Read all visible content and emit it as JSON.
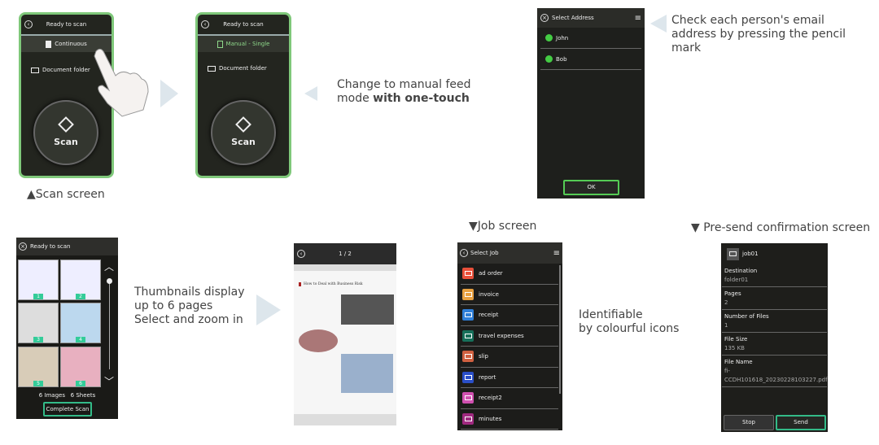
{
  "scan_screen_1": {
    "title": "Ready to scan",
    "mode": "Continuous",
    "folder": "Document folder",
    "scan": "Scan"
  },
  "scan_screen_2": {
    "title": "Ready to scan",
    "mode": "Manual - Single",
    "folder": "Document folder",
    "scan": "Scan"
  },
  "caption_scan": "▲Scan screen",
  "caption_manual_1": "Change to manual feed",
  "caption_manual_2a": "mode ",
  "caption_manual_2b": "with one-touch",
  "address": {
    "title": "Select Address",
    "items": [
      "John",
      "Bob"
    ],
    "ok": "OK"
  },
  "caption_address": "Check each person's email address by pressing the pencil mark",
  "thumbs": {
    "title": "Ready to scan",
    "pages": [
      "1",
      "2",
      "3",
      "4",
      "5",
      "6"
    ],
    "images": "6 Images",
    "sheets": "6 Sheets",
    "complete": "Complete Scan"
  },
  "caption_thumbs": [
    "Thumbnails display",
    "up to 6 pages",
    "Select and zoom in"
  ],
  "viewer": {
    "page": "1 / 2",
    "doc_title": "How to Deal with Business Risk"
  },
  "caption_job": "▼Job screen",
  "job": {
    "title": "Select Job",
    "items": [
      {
        "label": "ad order",
        "color": "#e8503a",
        "icon": "folder"
      },
      {
        "label": "invoice",
        "color": "#e8a040",
        "icon": "mail"
      },
      {
        "label": "receipt",
        "color": "#2f7fd8",
        "icon": "folder"
      },
      {
        "label": "travel expenses",
        "color": "#16705a",
        "icon": "folder"
      },
      {
        "label": "slip",
        "color": "#d06040",
        "icon": "mail"
      },
      {
        "label": "report",
        "color": "#2a4fc8",
        "icon": "folder"
      },
      {
        "label": "receipt2",
        "color": "#d050b0",
        "icon": "mail"
      },
      {
        "label": "minutes",
        "color": "#a02a80",
        "icon": "folder"
      }
    ]
  },
  "caption_icons": [
    "Identifiable",
    "by colourful icons"
  ],
  "caption_presend": "▼ Pre-send confirmation screen",
  "presend": {
    "job": "job01",
    "fields": [
      {
        "label": "Destination",
        "value": "folder01"
      },
      {
        "label": "Pages",
        "value": "2"
      },
      {
        "label": "Number of Files",
        "value": "1"
      },
      {
        "label": "File Size",
        "value": "135 KB"
      },
      {
        "label": "File Name",
        "value": "fi-CCDH101618_20230228103227.pdf"
      }
    ],
    "stop": "Stop",
    "send": "Send"
  },
  "accent": "#7fc87a"
}
